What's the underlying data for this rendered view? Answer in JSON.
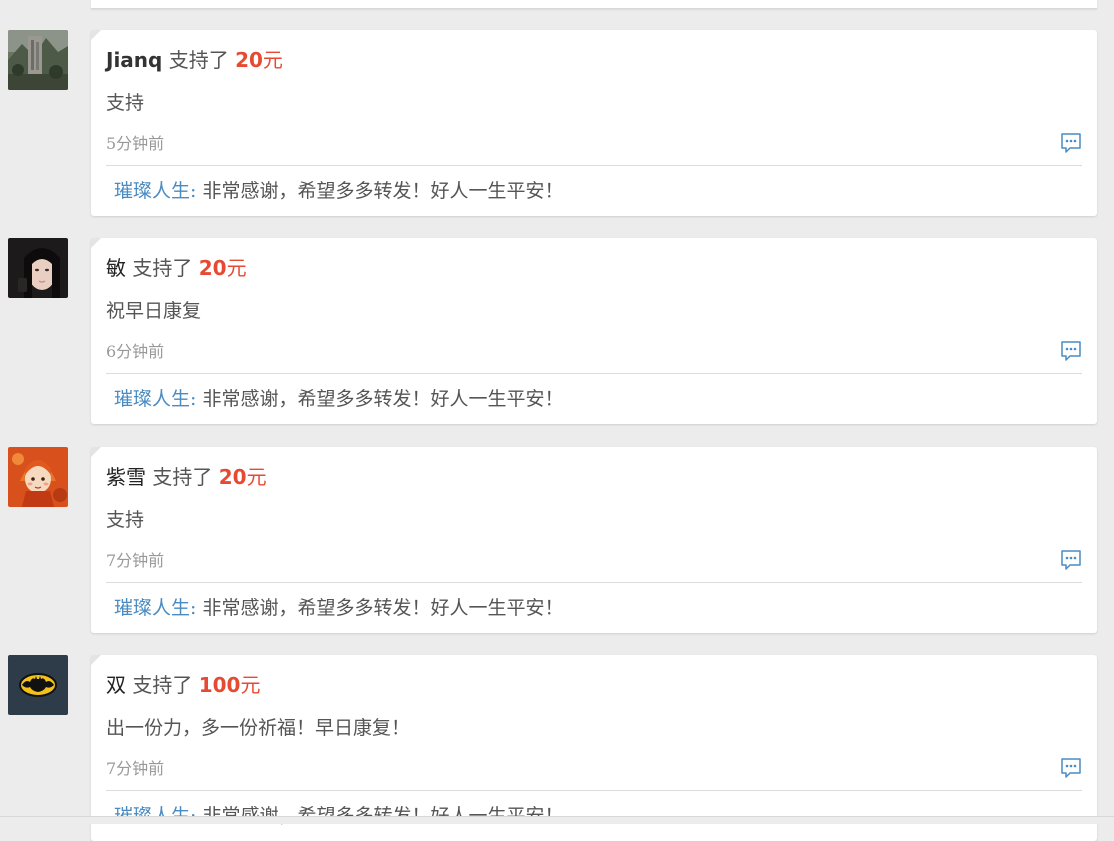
{
  "donations": [
    {
      "donor": "Jianq",
      "verb": "支持了",
      "amount": "20",
      "unit": "元",
      "message": "支持",
      "time": "5分钟前",
      "reply_author": "璀璨人生:",
      "reply_text": " 非常感谢，希望多多转发！好人一生平安！",
      "avatar_icon": "mountain-photo-avatar"
    },
    {
      "donor": "敏",
      "verb": "支持了",
      "amount": "20",
      "unit": "元",
      "message": "祝早日康复",
      "time": "6分钟前",
      "reply_author": "璀璨人生:",
      "reply_text": " 非常感谢，希望多多转发！好人一生平安！",
      "avatar_icon": "girl-photo-avatar"
    },
    {
      "donor": "紫雪",
      "verb": "支持了",
      "amount": "20",
      "unit": "元",
      "message": "支持",
      "time": "7分钟前",
      "reply_author": "璀璨人生:",
      "reply_text": " 非常感谢，希望多多转发！好人一生平安！",
      "avatar_icon": "cartoon-girl-avatar"
    },
    {
      "donor": "双",
      "verb": "支持了",
      "amount": "100",
      "unit": "元",
      "message": "出一份力，多一份祈福！早日康复！",
      "time": "7分钟前",
      "reply_author": "璀璨人生:",
      "reply_text": " 非常感谢，希望多多转发！好人一生平安！",
      "avatar_icon": "batman-logo-avatar"
    }
  ],
  "colors": {
    "background": "#ececec",
    "amount": "#e64a32",
    "reply_author": "#4a8bc2",
    "icon": "#4a8bc2"
  }
}
